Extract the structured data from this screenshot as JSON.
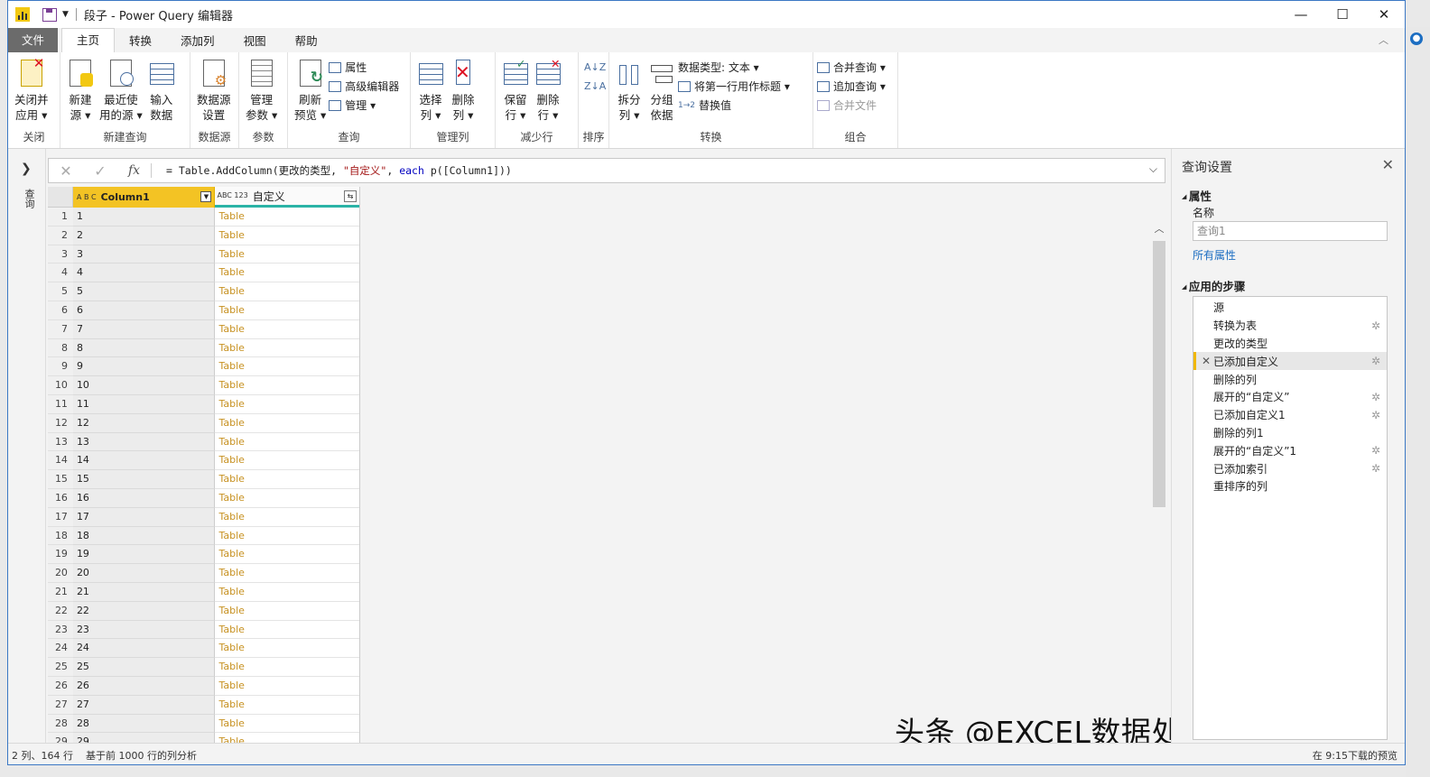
{
  "window": {
    "title": "段子 - Power Query 编辑器",
    "minimize": "—",
    "maximize": "☐",
    "close": "✕"
  },
  "tabs": {
    "file": "文件",
    "items": [
      "主页",
      "转换",
      "添加列",
      "视图",
      "帮助"
    ],
    "active": "主页"
  },
  "ribbon": {
    "close_group": {
      "label": "关闭",
      "close_apply": [
        "关闭并",
        "应用 ▾"
      ]
    },
    "new_query_group": {
      "label": "新建查询",
      "new_source": [
        "新建",
        "源 ▾"
      ],
      "recent_sources": [
        "最近使",
        "用的源 ▾"
      ],
      "enter_data": [
        "输入",
        "数据"
      ]
    },
    "datasource_group": {
      "label": "数据源",
      "settings": [
        "数据源",
        "设置"
      ]
    },
    "params_group": {
      "label": "参数",
      "manage": [
        "管理",
        "参数 ▾"
      ]
    },
    "query_group": {
      "label": "查询",
      "refresh": [
        "刷新",
        "预览 ▾"
      ],
      "properties": "属性",
      "advanced_editor": "高级编辑器",
      "manage": "管理 ▾"
    },
    "manage_cols_group": {
      "label": "管理列",
      "choose": [
        "选择",
        "列 ▾"
      ],
      "remove": [
        "删除",
        "列 ▾"
      ]
    },
    "reduce_rows_group": {
      "label": "减少行",
      "keep": [
        "保留",
        "行 ▾"
      ],
      "remove": [
        "删除",
        "行 ▾"
      ]
    },
    "sort_group": {
      "label": "排序"
    },
    "transform_group": {
      "label": "转换",
      "split": [
        "拆分",
        "列 ▾"
      ],
      "group_by": [
        "分组",
        "依据"
      ],
      "data_type": "数据类型: 文本 ▾",
      "first_row_header": "将第一行用作标题 ▾",
      "replace_values": "替换值"
    },
    "combine_group": {
      "label": "组合",
      "merge": "合并查询 ▾",
      "append": "追加查询 ▾",
      "combine_files": "合并文件"
    }
  },
  "left_strip": {
    "label": "查询"
  },
  "formula": {
    "prefix": "= Table.AddColumn(更改的类型, ",
    "string": "\"自定义\"",
    "mid": ", ",
    "keyword": "each",
    "suffix": " p([Column1]))"
  },
  "grid": {
    "columns": [
      {
        "type": "A B C",
        "name": "Column1"
      },
      {
        "type": "ABC 123",
        "name": "自定义"
      }
    ],
    "rows": [
      [
        "1",
        "1",
        "Table"
      ],
      [
        "2",
        "2",
        "Table"
      ],
      [
        "3",
        "3",
        "Table"
      ],
      [
        "4",
        "4",
        "Table"
      ],
      [
        "5",
        "5",
        "Table"
      ],
      [
        "6",
        "6",
        "Table"
      ],
      [
        "7",
        "7",
        "Table"
      ],
      [
        "8",
        "8",
        "Table"
      ],
      [
        "9",
        "9",
        "Table"
      ],
      [
        "10",
        "10",
        "Table"
      ],
      [
        "11",
        "11",
        "Table"
      ],
      [
        "12",
        "12",
        "Table"
      ],
      [
        "13",
        "13",
        "Table"
      ],
      [
        "14",
        "14",
        "Table"
      ],
      [
        "15",
        "15",
        "Table"
      ],
      [
        "16",
        "16",
        "Table"
      ],
      [
        "17",
        "17",
        "Table"
      ],
      [
        "18",
        "18",
        "Table"
      ],
      [
        "19",
        "19",
        "Table"
      ],
      [
        "20",
        "20",
        "Table"
      ],
      [
        "21",
        "21",
        "Table"
      ],
      [
        "22",
        "22",
        "Table"
      ],
      [
        "23",
        "23",
        "Table"
      ],
      [
        "24",
        "24",
        "Table"
      ],
      [
        "25",
        "25",
        "Table"
      ],
      [
        "26",
        "26",
        "Table"
      ],
      [
        "27",
        "27",
        "Table"
      ],
      [
        "28",
        "28",
        "Table"
      ],
      [
        "29",
        "29",
        "Table"
      ]
    ]
  },
  "query_settings": {
    "title": "查询设置",
    "properties_section": "属性",
    "name_label": "名称",
    "name_value": "查询1",
    "all_properties": "所有属性",
    "steps_section": "应用的步骤",
    "steps": [
      {
        "label": "源",
        "gear": false
      },
      {
        "label": "转换为表",
        "gear": true
      },
      {
        "label": "更改的类型",
        "gear": false
      },
      {
        "label": "已添加自定义",
        "gear": true,
        "selected": true
      },
      {
        "label": "删除的列",
        "gear": false
      },
      {
        "label": "展开的“自定义”",
        "gear": true
      },
      {
        "label": "已添加自定义1",
        "gear": true
      },
      {
        "label": "删除的列1",
        "gear": false
      },
      {
        "label": "展开的“自定义”1",
        "gear": true
      },
      {
        "label": "已添加索引",
        "gear": true
      },
      {
        "label": "重排序的列",
        "gear": false
      }
    ]
  },
  "status": {
    "cols_rows": "2 列、164 行",
    "profiling": "基于前 1000 行的列分析",
    "download": "在 9:15下载的预览"
  },
  "watermark": "头条 @EXCEL数据处理与分析",
  "colors": {
    "accent": "#f3c324",
    "link": "#1c6ec2",
    "table_text": "#c79121",
    "teal": "#2ab3a6"
  }
}
